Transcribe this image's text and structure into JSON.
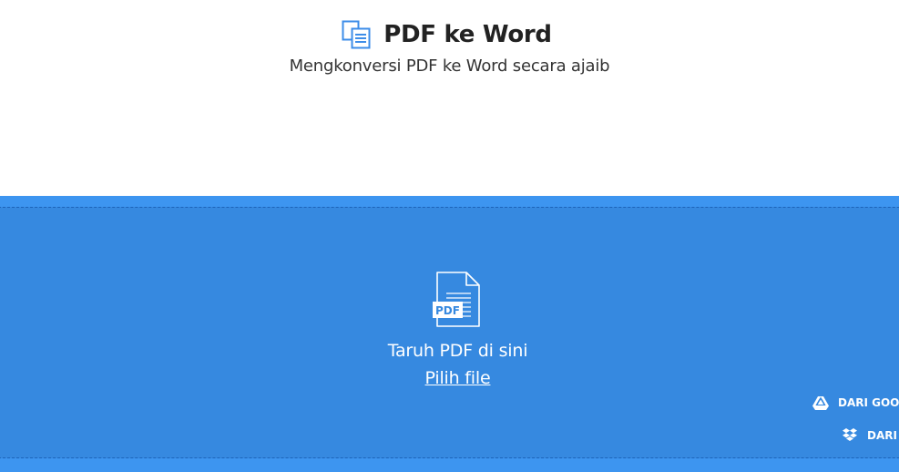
{
  "header": {
    "title": "PDF ke Word",
    "subtitle": "Mengkonversi PDF ke Word secara ajaib"
  },
  "dropzone": {
    "drop_text": "Taruh PDF di sini",
    "choose_file_label": "Pilih file",
    "file_badge": "PDF"
  },
  "sources": {
    "google_drive_label": "DARI GOOGLE DRIVE",
    "dropbox_label": "DARI DROPBOX"
  },
  "icons": {
    "title_icon": "pdf-to-word-icon",
    "file_icon": "pdf-file-icon",
    "google_drive_icon": "google-drive-icon",
    "dropbox_icon": "dropbox-icon"
  },
  "colors": {
    "accent": "#3d95f0",
    "dropzone": "#3689e0",
    "title_icon": "#3d8de8",
    "text_dark": "#222222",
    "on_accent": "#ffffff"
  }
}
